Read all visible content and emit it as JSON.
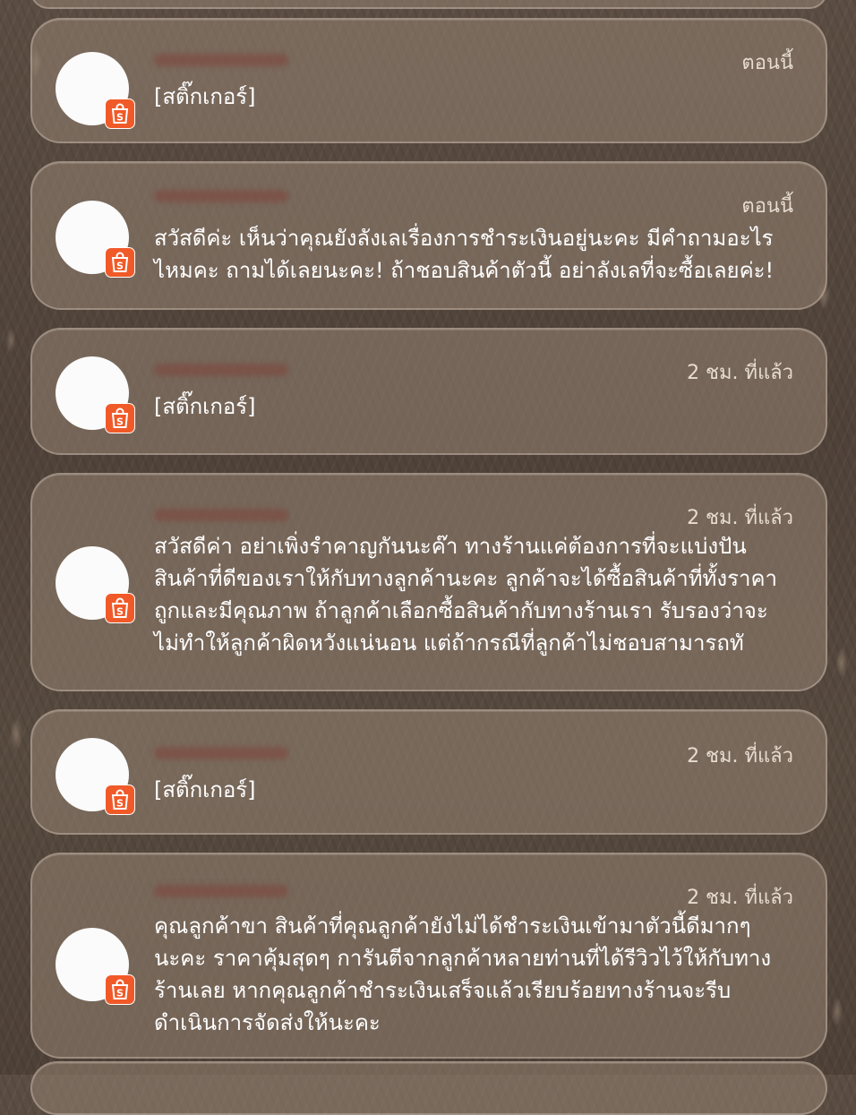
{
  "notifications": [
    {
      "time": "ตอนนี้",
      "lines": [
        "[สติ๊กเกอร์]"
      ]
    },
    {
      "time": "ตอนนี้",
      "lines": [
        "สวัสดีค่ะ เห็นว่าคุณยังลังเลเรื่องการชำระเงินอยู่นะคะ มีคำถามอะไร",
        "ไหมคะ ถามได้เลยนะคะ! ถ้าชอบสินค้าตัวนี้ อย่าลังเลที่จะซื้อเลยค่ะ!"
      ]
    },
    {
      "time": "2 ชม. ที่แล้ว",
      "lines": [
        "[สติ๊กเกอร์]"
      ]
    },
    {
      "time": "2 ชม. ที่แล้ว",
      "lines": [
        "สวัสดีค่า อย่าเพิ่งรำคาญกันนะค๊า ทางร้านแค่ต้องการที่จะแบ่งปัน",
        "สินค้าที่ดีของเราให้กับทางลูกค้านะคะ ลูกค้าจะได้ซื้อสินค้าที่ทั้งราคา",
        "ถูกและมีคุณภาพ ถ้าลูกค้าเลือกซื้อสินค้ากับทางร้านเรา รับรองว่าจะ",
        "ไม่ทำให้ลูกค้าผิดหวังแน่นอน แต่ถ้ากรณีที่ลูกค้าไม่ชอบสามารถทั"
      ]
    },
    {
      "time": "2 ชม. ที่แล้ว",
      "lines": [
        "[สติ๊กเกอร์]"
      ]
    },
    {
      "time": "2 ชม. ที่แล้ว",
      "lines": [
        "คุณลูกค้าขา สินค้าที่คุณลูกค้ายังไม่ได้ชำระเงินเข้ามาตัวนี้ดีมากๆ",
        "นะคะ ราคาคุ้มสุดๆ การันตีจากลูกค้าหลายท่านที่ได้รีวิวไว้ให้กับทาง",
        "ร้านเลย หากคุณลูกค้าชำระเงินเสร็จแล้วเรียบร้อยทางร้านจะรีบ",
        "ดำเนินการจัดส่งให้นะคะ"
      ]
    }
  ],
  "badge_icon": "shopee-bag-icon",
  "colors": {
    "badge": "#f05a28",
    "card": "#968473",
    "text": "#ffffff",
    "time": "#e6dccf"
  }
}
